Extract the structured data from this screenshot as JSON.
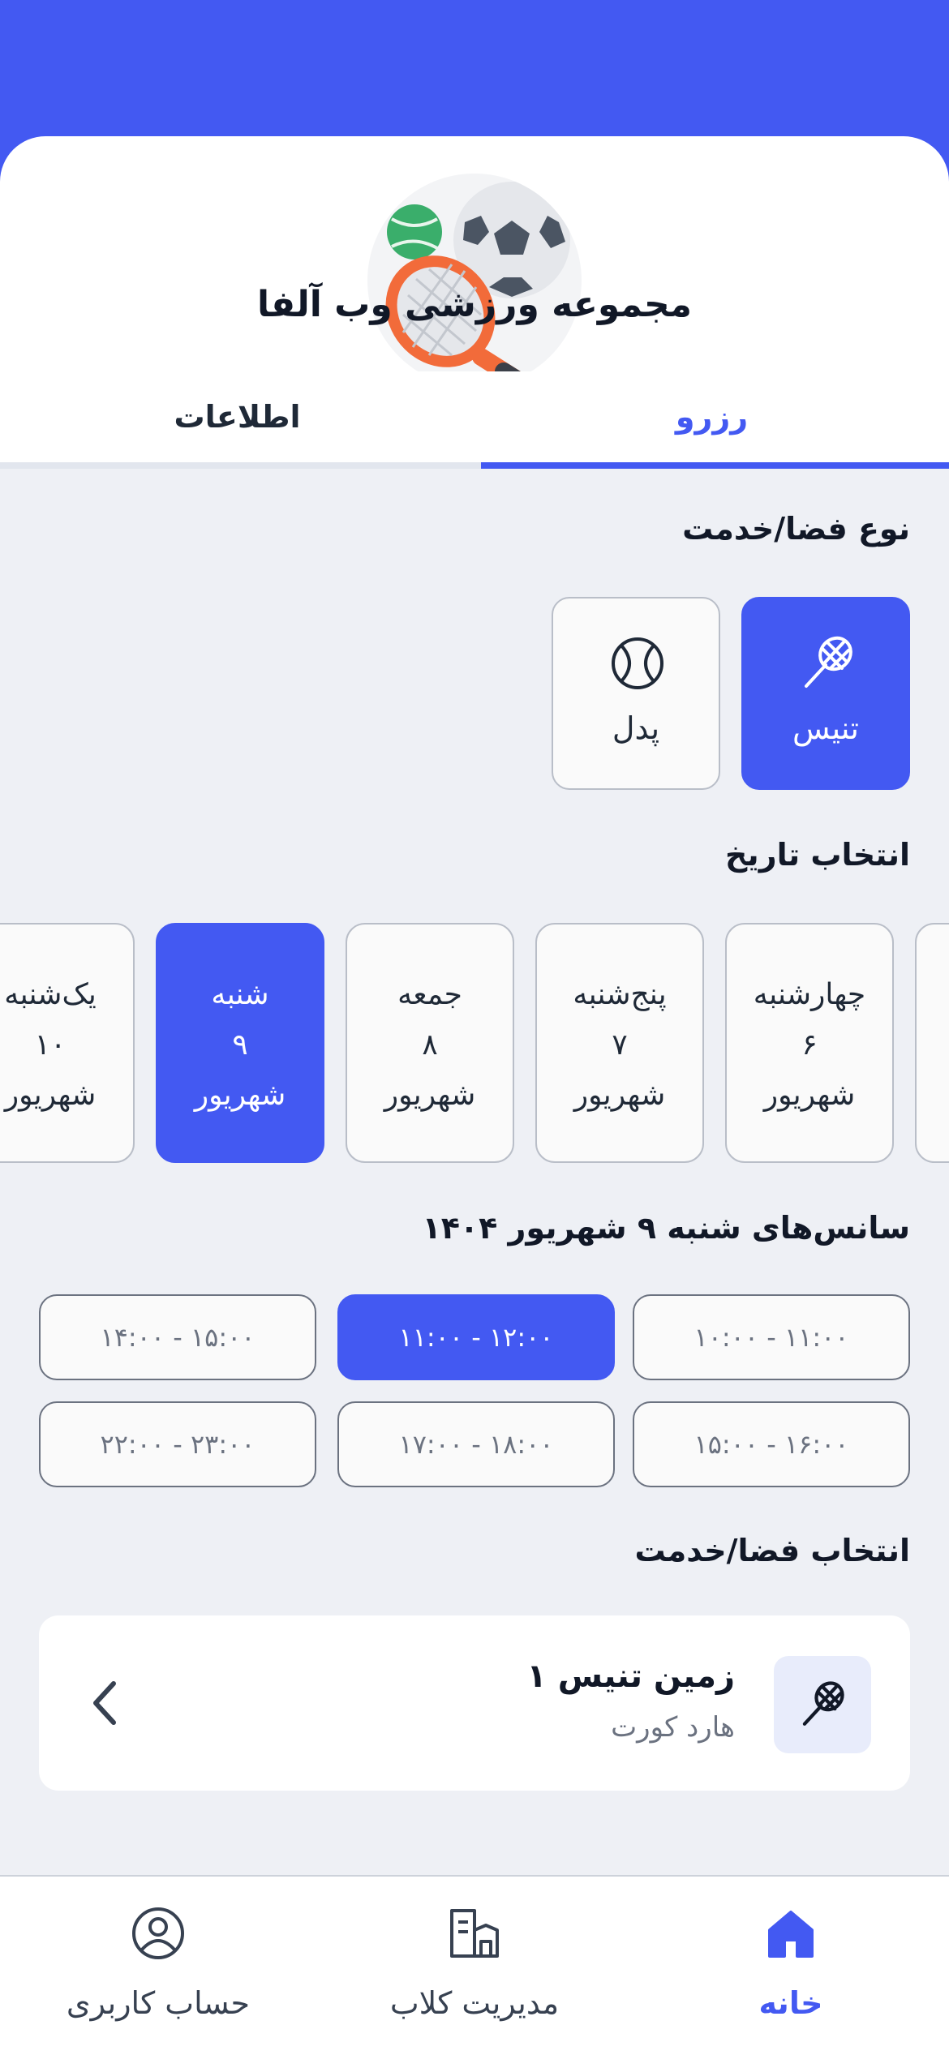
{
  "colors": {
    "accent": "#4359f2",
    "background": "#eef0f5",
    "card": "#fafafa"
  },
  "club": {
    "name": "مجموعه ورزشی وب آلفا"
  },
  "tabs": {
    "reserve": "رزرو",
    "info": "اطلاعات"
  },
  "sections": {
    "service_type": "نوع فضا/خدمت",
    "date_select": "انتخاب تاریخ",
    "sessions": "سانس‌های شنبه ۹ شهریور ۱۴۰۴",
    "space_select": "انتخاب فضا/خدمت"
  },
  "services": [
    {
      "label": "تنیس",
      "icon": "tennis-racket-icon",
      "selected": true
    },
    {
      "label": "پدل",
      "icon": "ball-icon",
      "selected": false
    }
  ],
  "dates": [
    {
      "day": "یک‌شنبه",
      "num": "۱۰",
      "month": "شهریور",
      "selected": false
    },
    {
      "day": "شنبه",
      "num": "۹",
      "month": "شهریور",
      "selected": true
    },
    {
      "day": "جمعه",
      "num": "۸",
      "month": "شهریور",
      "selected": false
    },
    {
      "day": "پنج‌شنبه",
      "num": "۷",
      "month": "شهریور",
      "selected": false
    },
    {
      "day": "چهارشنبه",
      "num": "۶",
      "month": "شهریور",
      "selected": false
    }
  ],
  "slots": [
    {
      "label": "۱۰:۰۰ - ۱۱:۰۰",
      "selected": false
    },
    {
      "label": "۱۱:۰۰ - ۱۲:۰۰",
      "selected": true
    },
    {
      "label": "۱۴:۰۰ - ۱۵:۰۰",
      "selected": false
    },
    {
      "label": "۱۵:۰۰ - ۱۶:۰۰",
      "selected": false
    },
    {
      "label": "۱۷:۰۰ - ۱۸:۰۰",
      "selected": false
    },
    {
      "label": "۲۲:۰۰ - ۲۳:۰۰",
      "selected": false
    }
  ],
  "court": {
    "name": "زمین تنیس ۱",
    "type": "هارد کورت",
    "icon": "tennis-racket-icon"
  },
  "nav": [
    {
      "label": "خانه",
      "icon": "home-icon",
      "active": true
    },
    {
      "label": "مدیریت کلاب",
      "icon": "club-management-icon",
      "active": false
    },
    {
      "label": "حساب کاربری",
      "icon": "user-account-icon",
      "active": false
    }
  ]
}
